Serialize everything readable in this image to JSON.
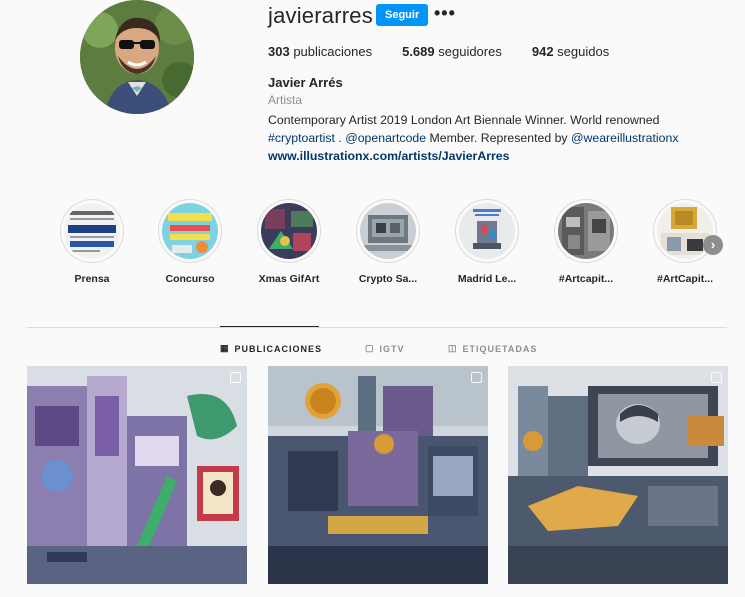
{
  "profile": {
    "username": "javierarres",
    "follow_label": "Seguir",
    "more_label": "•••",
    "full_name": "Javier Arrés",
    "category": "Artista",
    "bio_line1": "Contemporary Artist 2019 London Art Biennale Winner. World renowned",
    "bio_tag1": "#cryptoartist",
    "bio_sep": " . ",
    "bio_tag2": "@openartcode",
    "bio_mid": " Member. Represented by ",
    "bio_tag3": "@weareillustrationx",
    "website": "www.illustrationx.com/artists/JavierArres"
  },
  "stats": {
    "posts_count": "303",
    "posts_label": " publicaciones",
    "followers_count": "5.689",
    "followers_label": " seguidores",
    "following_count": "942",
    "following_label": " seguidos"
  },
  "highlights": [
    {
      "label": "Prensa",
      "icon": "newspaper-thumbnail"
    },
    {
      "label": "Concurso",
      "icon": "contest-thumbnail"
    },
    {
      "label": "Xmas GifArt",
      "icon": "xmas-thumbnail"
    },
    {
      "label": "Crypto Sa...",
      "icon": "crypto-thumbnail"
    },
    {
      "label": "Madrid Le...",
      "icon": "madrid-thumbnail"
    },
    {
      "label": "#Artcapit...",
      "icon": "artcapital-thumbnail"
    },
    {
      "label": "#ArtCapit...",
      "icon": "artcapital2-thumbnail"
    }
  ],
  "highlights_next_icon": "chevron-right-icon",
  "tabs": [
    {
      "label": "PUBLICACIONES",
      "icon": "grid-icon",
      "active": true
    },
    {
      "label": "IGTV",
      "icon": "igtv-icon",
      "active": false
    },
    {
      "label": "ETIQUETADAS",
      "icon": "tagged-icon",
      "active": false
    }
  ],
  "colors": {
    "accent": "#0095f6",
    "link": "#00376b",
    "muted": "#8e8e8e",
    "background": "#fafafa"
  }
}
